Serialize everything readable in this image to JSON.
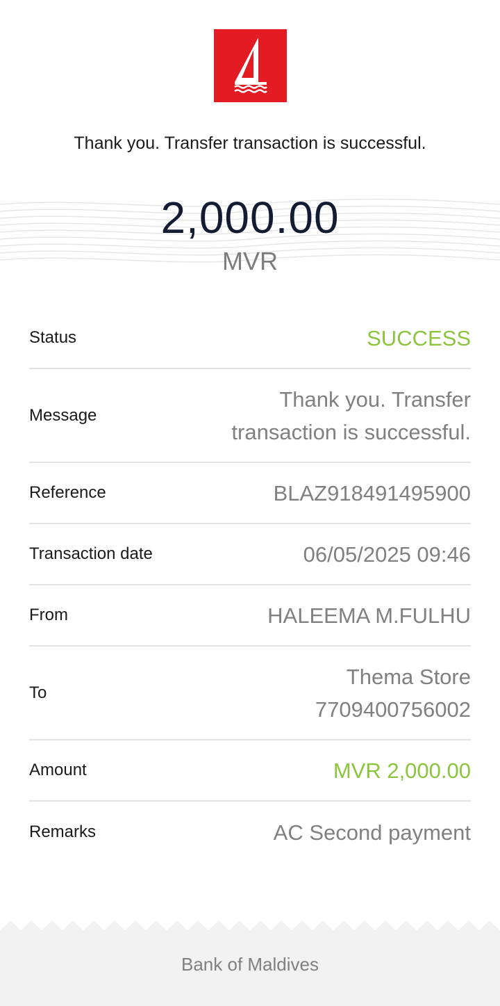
{
  "brand": {
    "logo_icon": "sailboat-icon",
    "logo_color": "#e31b23"
  },
  "headline": "Thank you. Transfer transaction is successful.",
  "amount": {
    "value": "2,000.00",
    "currency": "MVR"
  },
  "details": {
    "status": {
      "label": "Status",
      "value": "SUCCESS"
    },
    "message": {
      "label": "Message",
      "value": "Thank you. Transfer transaction is successful."
    },
    "reference": {
      "label": "Reference",
      "value": "BLAZ918491495900"
    },
    "transaction_date": {
      "label": "Transaction date",
      "value": "06/05/2025 09:46"
    },
    "from": {
      "label": "From",
      "value": "HALEEMA M.FULHU"
    },
    "to": {
      "label": "To",
      "name": "Thema Store",
      "account": "7709400756002"
    },
    "amount": {
      "label": "Amount",
      "value": "MVR 2,000.00"
    },
    "remarks": {
      "label": "Remarks",
      "value": "AC Second payment"
    }
  },
  "footer": {
    "text": "Bank of Maldives"
  },
  "colors": {
    "success_green": "#8cc43e",
    "value_gray": "#808080",
    "amount_navy": "#141c33"
  }
}
